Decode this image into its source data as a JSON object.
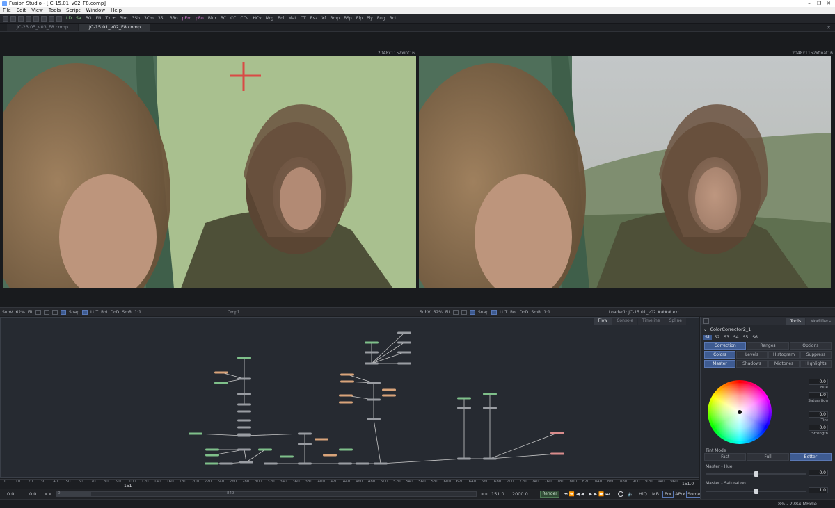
{
  "window": {
    "title": "Fusion Studio - [JC-15.01_v02_F8.comp]",
    "minimize": "–",
    "maximize": "❐",
    "close": "✕"
  },
  "menu": [
    "File",
    "Edit",
    "View",
    "Tools",
    "Script",
    "Window",
    "Help"
  ],
  "toolbar": [
    "LD",
    "SV",
    "BG",
    "FN",
    "Txt+",
    "3Im",
    "3Sh",
    "3Cm",
    "3SL",
    "3Rn",
    "pEm",
    "pRn",
    "Blur",
    "BC",
    "CC",
    "CCv",
    "HCv",
    "Mrg",
    "Bol",
    "Mat",
    "CT",
    "Rsz",
    "Xf",
    "Bmp",
    "BSp",
    "Elp",
    "Ply",
    "Rng",
    "Rct"
  ],
  "tabs": [
    {
      "label": "JC-23.05_v03_F8.comp",
      "active": false
    },
    {
      "label": "JC-15.01_v02_F8.comp",
      "active": true
    }
  ],
  "viewer_left": {
    "resolution": "2048x1152xint16",
    "label": "Crop1"
  },
  "viewer_right": {
    "resolution": "2048x1152xfloat16",
    "label": "Loader1: JC-15.01_v02.####.exr"
  },
  "viewerbar": {
    "subv": "SubV",
    "zoom": "62%",
    "fit": "Fit",
    "snap": "Snap",
    "lut": "LUT",
    "roi": "RoI",
    "dod": "DoD",
    "smr": "SmR",
    "ratio": "1:1"
  },
  "flow_tabs": [
    {
      "label": "Flow",
      "active": true
    },
    {
      "label": "Console",
      "active": false
    },
    {
      "label": "Timeline",
      "active": false
    },
    {
      "label": "Spline",
      "active": false
    }
  ],
  "ruler_ticks": [
    "0",
    "10",
    "20",
    "30",
    "40",
    "50",
    "60",
    "70",
    "80",
    "90",
    "100",
    "120",
    "140",
    "160",
    "180",
    "200",
    "220",
    "240",
    "260",
    "280",
    "300",
    "320",
    "340",
    "360",
    "380",
    "400",
    "420",
    "440",
    "460",
    "480",
    "500",
    "520",
    "540",
    "560",
    "580",
    "600",
    "620",
    "640",
    "660",
    "680",
    "700",
    "720",
    "740",
    "760",
    "780",
    "800",
    "820",
    "840",
    "860",
    "880",
    "900",
    "920",
    "940",
    "960"
  ],
  "timeline": {
    "current": "151",
    "end_label": "151.0"
  },
  "transport": {
    "start": "0.0",
    "global_start": "0.0",
    "back": "<<",
    "render_start": "0",
    "mid_frame": "849",
    "fwd": ">>",
    "render_end": "151.0",
    "global_end": "2000.0",
    "render": "Render",
    "hiq": "HiQ",
    "mb": "MB",
    "prx": "Prx",
    "aprx": "APrx",
    "some": "Some"
  },
  "status": {
    "memory": "8% - 2784 MB",
    "state": "Idle"
  },
  "inspector": {
    "tabs": [
      {
        "label": "Tools",
        "active": true
      },
      {
        "label": "Modifiers",
        "active": false
      }
    ],
    "tool_name": "ColorCorrector2_1",
    "sub_tabs": [
      "S1",
      "S2",
      "S3",
      "S4",
      "S5",
      "S6"
    ],
    "main_tabs": [
      {
        "label": "Correction",
        "active": true
      },
      {
        "label": "Ranges",
        "active": false
      },
      {
        "label": "Options",
        "active": false
      }
    ],
    "color_modes": [
      {
        "label": "Colors",
        "active": true
      },
      {
        "label": "Levels",
        "active": false
      },
      {
        "label": "Histogram",
        "active": false
      },
      {
        "label": "Suppress",
        "active": false
      }
    ],
    "ranges": [
      {
        "label": "Master",
        "active": true
      },
      {
        "label": "Shadows",
        "active": false
      },
      {
        "label": "Midtones",
        "active": false
      },
      {
        "label": "Highlights",
        "active": false
      }
    ],
    "wheel_fields": [
      {
        "value": "0.0",
        "label": "Hue"
      },
      {
        "value": "1.0",
        "label": "Saturation"
      },
      {
        "value": "0.0",
        "label": "Tint"
      },
      {
        "value": "0.0",
        "label": "Strength"
      }
    ],
    "tint_mode": {
      "label": "Tint Mode",
      "options": [
        {
          "label": "Fast",
          "active": false
        },
        {
          "label": "Full",
          "active": false
        },
        {
          "label": "Better",
          "active": true
        }
      ]
    },
    "master_hue": {
      "label": "Master - Hue",
      "value": "0.0",
      "fraction": 0.5
    },
    "master_saturation": {
      "label": "Master - Saturation",
      "value": "1.0",
      "fraction": 0.5
    }
  },
  "colors": {
    "accent": "#3e5b91",
    "node_green": "#7fc08a",
    "node_orange": "#d9a47a",
    "node_red": "#d98c8c",
    "node_grey": "#9a9da3",
    "greenscreen": "#a9c08f"
  }
}
